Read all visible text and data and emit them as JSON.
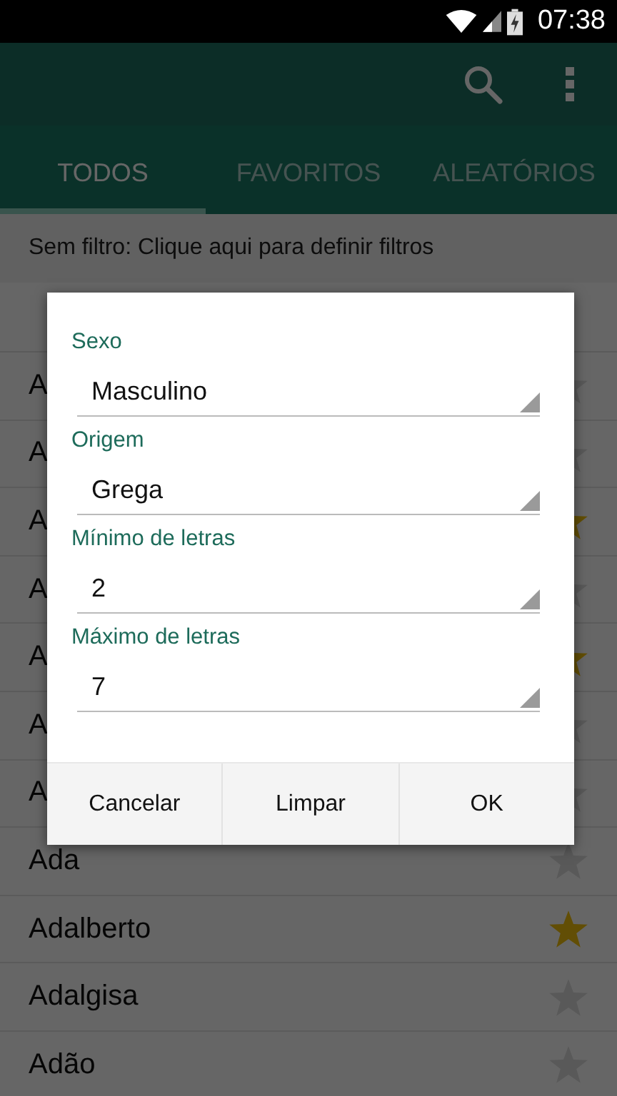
{
  "status_bar": {
    "time": "07:38"
  },
  "tabs": [
    {
      "label": "TODOS",
      "selected": true
    },
    {
      "label": "FAVORITOS",
      "selected": false
    },
    {
      "label": "ALEATÓRIOS",
      "selected": false
    }
  ],
  "filter_bar": {
    "text": "Sem filtro: Clique aqui para definir filtros"
  },
  "names": [
    {
      "name": "A",
      "favorite": false
    },
    {
      "name": "A",
      "favorite": false
    },
    {
      "name": "A",
      "favorite": true
    },
    {
      "name": "A",
      "favorite": false
    },
    {
      "name": "A",
      "favorite": true
    },
    {
      "name": "A",
      "favorite": false
    },
    {
      "name": "A",
      "favorite": false
    },
    {
      "name": "Ada",
      "favorite": false
    },
    {
      "name": "Adalberto",
      "favorite": true
    },
    {
      "name": "Adalgisa",
      "favorite": false
    },
    {
      "name": "Adão",
      "favorite": false
    }
  ],
  "dialog": {
    "fields": [
      {
        "label": "Sexo",
        "value": "Masculino"
      },
      {
        "label": "Origem",
        "value": "Grega"
      },
      {
        "label": "Mínimo de letras",
        "value": "2"
      },
      {
        "label": "Máximo de letras",
        "value": "7"
      }
    ],
    "buttons": [
      "Cancelar",
      "Limpar",
      "OK"
    ]
  }
}
